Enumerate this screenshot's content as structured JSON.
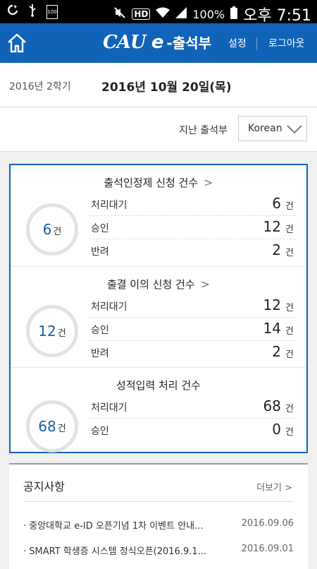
{
  "status_bar": {
    "battery_small": "100",
    "hd": "HD",
    "battery_percent": "100%",
    "time": "오후 7:51"
  },
  "app_bar": {
    "brand_cau": "CAU",
    "brand_e": "e",
    "brand_title": "-출석부",
    "settings_label": "설정",
    "logout_label": "로그아웃"
  },
  "date_bar": {
    "semester": "2016년 2학기",
    "today": "2016년 10월 20일(목)"
  },
  "past_bar": {
    "label": "지난 출석부",
    "language": "Korean"
  },
  "summary": {
    "sections": [
      {
        "title": "출석인정제 신청 건수",
        "total": "6",
        "unit": "건",
        "rows": [
          {
            "label": "처리대기",
            "value": "6",
            "unit": "건"
          },
          {
            "label": "승인",
            "value": "12",
            "unit": "건"
          },
          {
            "label": "반려",
            "value": "2",
            "unit": "건"
          }
        ]
      },
      {
        "title": "출결 이의 신청 건수",
        "total": "12",
        "unit": "건",
        "rows": [
          {
            "label": "처리대기",
            "value": "12",
            "unit": "건"
          },
          {
            "label": "승인",
            "value": "14",
            "unit": "건"
          },
          {
            "label": "반려",
            "value": "2",
            "unit": "건"
          }
        ]
      },
      {
        "title": "성적입력 처리 건수",
        "total": "68",
        "unit": "건",
        "rows": [
          {
            "label": "처리대기",
            "value": "68",
            "unit": "건"
          },
          {
            "label": "승인",
            "value": "0",
            "unit": "건"
          }
        ]
      }
    ]
  },
  "notice": {
    "title": "공지사항",
    "more_label": "더보기 >",
    "items": [
      {
        "text": "· 중앙대학교 e-ID 오픈기념 1차 이벤트 안내...",
        "date": "2016.09.06"
      },
      {
        "text": "· SMART 학생증 시스템 정식오픈(2016.9.1...",
        "date": "2016.09.01"
      }
    ]
  },
  "colors": {
    "brand_blue": "#1163b8",
    "ring_number": "#1a5fa8"
  }
}
